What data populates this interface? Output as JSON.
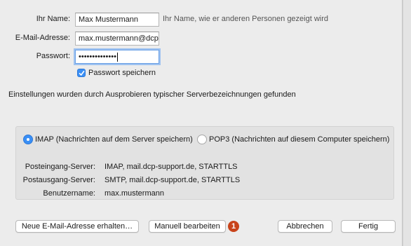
{
  "account": {
    "name_label": "Ihr Name:",
    "name_value": "Max Mustermann",
    "name_hint": "Ihr Name, wie er anderen Personen gezeigt wird",
    "email_label": "E-Mail-Adresse:",
    "email_value": "max.mustermann@dcp",
    "password_label": "Passwort:",
    "password_value": "••••••••••••••",
    "save_password_label": "Passwort speichern",
    "save_password_checked": true
  },
  "status_message": "Einstellungen wurden durch Ausprobieren typischer Serverbezeichnungen gefunden",
  "protocol": {
    "imap_label": "IMAP (Nachrichten auf dem Server speichern)",
    "pop3_label": "POP3 (Nachrichten auf diesem Computer speichern)",
    "selected": "IMAP"
  },
  "servers": {
    "incoming_label": "Posteingang-Server:",
    "incoming_value": "IMAP, mail.dcp-support.de, STARTTLS",
    "outgoing_label": "Postausgang-Server:",
    "outgoing_value": "SMTP, mail.dcp-support.de, STARTTLS",
    "username_label": "Benutzername:",
    "username_value": "max.mustermann"
  },
  "buttons": {
    "new_address": "Neue E-Mail-Adresse erhalten…",
    "manual_edit": "Manuell bearbeiten",
    "cancel": "Abbrechen",
    "done": "Fertig"
  },
  "annotation_badge": "1",
  "colors": {
    "accent": "#3a8ff5",
    "badge": "#c8431a",
    "focus_ring": "#9ec2f0"
  }
}
